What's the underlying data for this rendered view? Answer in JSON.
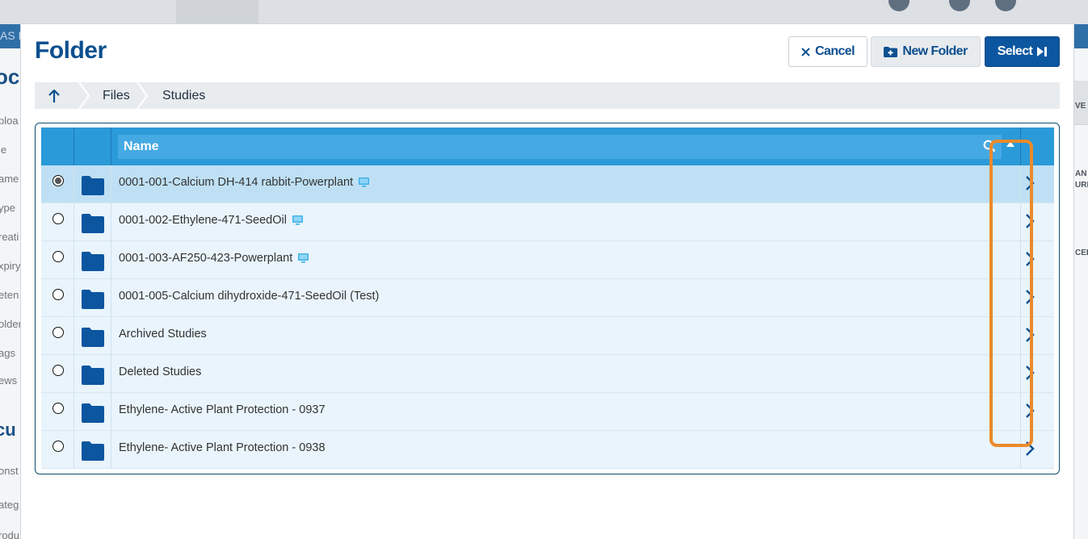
{
  "background": {
    "band_text": "AS D",
    "left_heading_1": "oc",
    "left_heading_2": "cu",
    "left_items": [
      "ploa",
      "le",
      "ame",
      "ype",
      "reati",
      "xpiry",
      "eten",
      "older",
      "ags",
      "ews",
      "onst",
      "ateg",
      "rodu"
    ],
    "right_labels": [
      "VE",
      "AN",
      "URN",
      "CEL"
    ]
  },
  "modal": {
    "title": "Folder",
    "cancel_label": "Cancel",
    "new_folder_label": "New Folder",
    "select_label": "Select"
  },
  "breadcrumb": {
    "items": [
      "Files",
      "Studies"
    ]
  },
  "table": {
    "name_header": "Name",
    "rows": [
      {
        "name": "0001-001-Calcium DH-414 rabbit-Powerplant",
        "selected": true,
        "has_monitor_icon": true
      },
      {
        "name": "0001-002-Ethylene-471-SeedOil",
        "selected": false,
        "has_monitor_icon": true
      },
      {
        "name": "0001-003-AF250-423-Powerplant",
        "selected": false,
        "has_monitor_icon": true
      },
      {
        "name": "0001-005-Calcium dihydroxide-471-SeedOil (Test)",
        "selected": false,
        "has_monitor_icon": false
      },
      {
        "name": "Archived Studies",
        "selected": false,
        "has_monitor_icon": false
      },
      {
        "name": "Deleted Studies",
        "selected": false,
        "has_monitor_icon": false
      },
      {
        "name": "Ethylene- Active Plant Protection - 0937",
        "selected": false,
        "has_monitor_icon": false
      },
      {
        "name": "Ethylene- Active Plant Protection - 0938",
        "selected": false,
        "has_monitor_icon": false
      }
    ]
  },
  "colors": {
    "primary": "#0c56a0",
    "header_bar": "#2b9ad9",
    "row_bg": "#e9f4fc",
    "row_selected_bg": "#bfe0f4",
    "highlight": "#e98a2c"
  },
  "icons": [
    "up-arrow-icon",
    "close-icon",
    "add-folder-icon",
    "select-arrow-icon",
    "search-icon",
    "sort-asc-icon",
    "folder-icon",
    "monitor-icon",
    "chevron-right-icon"
  ]
}
